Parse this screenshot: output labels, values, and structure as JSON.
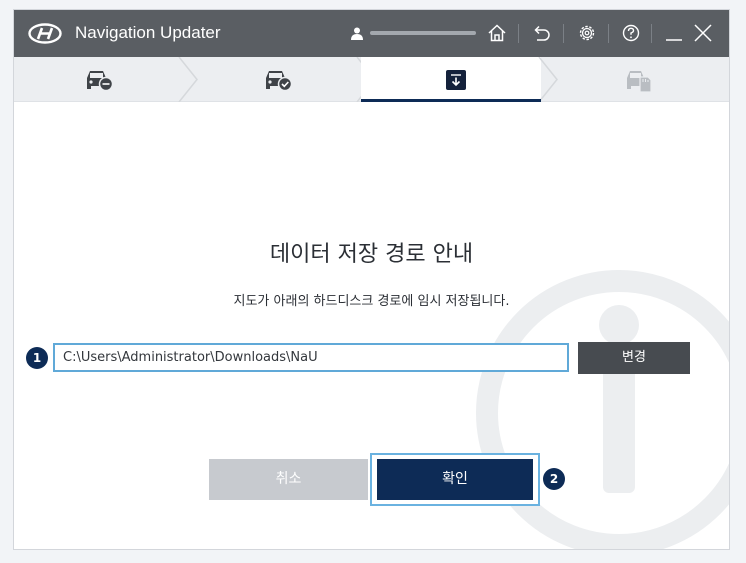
{
  "titlebar": {
    "app_title": "Navigation Updater",
    "icons": [
      "hyundai-logo",
      "user-icon",
      "home-icon",
      "back-icon",
      "settings-icon",
      "help-icon",
      "minimize-icon",
      "close-icon"
    ]
  },
  "steps": [
    {
      "icon": "car-minus-icon",
      "state": "done"
    },
    {
      "icon": "car-check-icon",
      "state": "done"
    },
    {
      "icon": "download-box-icon",
      "state": "active"
    },
    {
      "icon": "car-sd-card-icon",
      "state": "pending"
    }
  ],
  "main": {
    "heading": "데이터 저장 경로 안내",
    "subtitle": "지도가 아래의 하드디스크 경로에 임시 저장됩니다.",
    "path_value": "C:\\Users\\Administrator\\Downloads\\NaU",
    "change_label": "변경",
    "cancel_label": "취소",
    "ok_label": "확인",
    "marker_1": "1",
    "marker_2": "2"
  },
  "colors": {
    "titlebar": "#5a5e63",
    "accent": "#0d2b56",
    "focus": "#60a9d8",
    "disabled": "#c7cacf"
  }
}
